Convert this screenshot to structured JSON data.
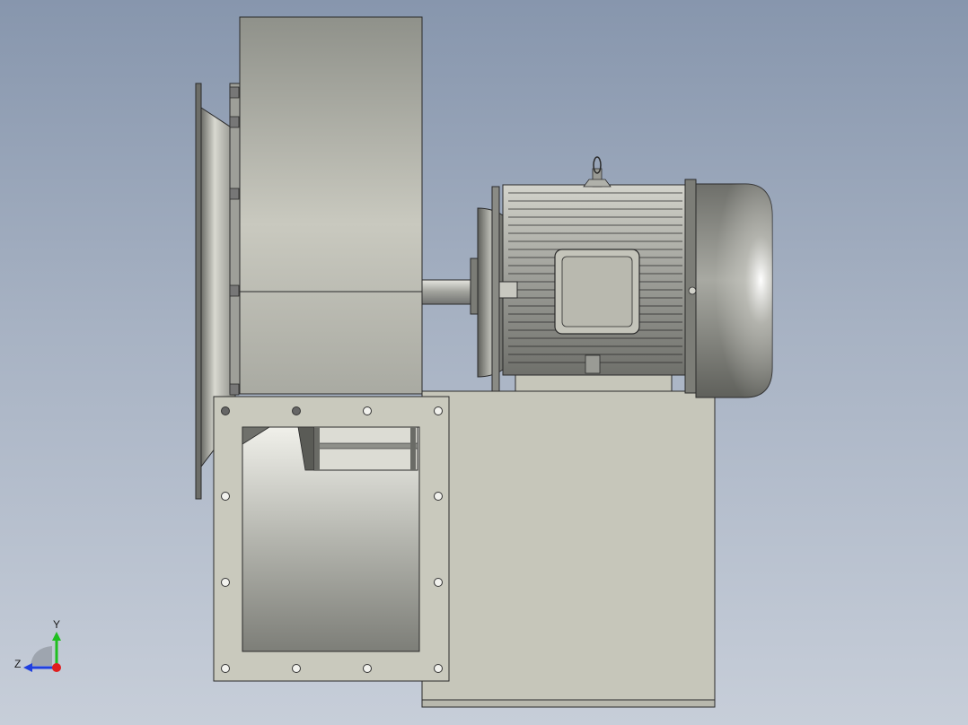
{
  "viewport": {
    "background_top": "#8796ad",
    "background_bottom": "#c7ced9",
    "model_color": "#c8c8bc",
    "edge_color": "#2a2a2a"
  },
  "triad": {
    "y_label": "Y",
    "z_label": "Z",
    "y_color": "#1fbf1f",
    "z_color": "#1f3fdf",
    "x_color": "#e01e1e"
  }
}
